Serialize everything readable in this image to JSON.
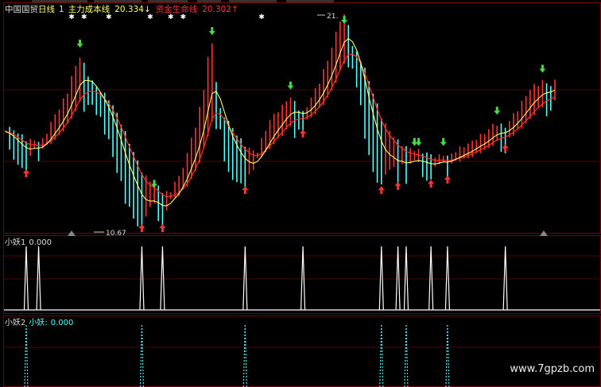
{
  "header": {
    "stock_name": "中国国贸",
    "period": "日线",
    "indicator_index": "1",
    "cost_line_label": "主力成本线",
    "cost_line_value": "20.334",
    "cost_line_arrow": "↓",
    "lifeline_label": "资金生命线",
    "lifeline_value": "20.302",
    "lifeline_arrow": "↑"
  },
  "main_panel": {
    "high_label": "21.",
    "low_label": "10.67"
  },
  "sub_panel_1": {
    "label": "小妖1",
    "value": "0.000"
  },
  "sub_panel_2": {
    "label": "小妖2",
    "legend": "小妖:",
    "value": "0.000"
  },
  "watermark": "www.7gpzb.com",
  "colors": {
    "up": "#ff3333",
    "down": "#54ffff",
    "cost_line": "#ffff66",
    "lifeline": "#ff2a2a",
    "panel_border": "#7a0000",
    "grid": "#5a0000",
    "buy_arrow": "#ff3333",
    "sell_arrow": "#44dd44",
    "spike_1": "#ffffff",
    "spike_2": "#54ffff"
  },
  "chart_data": {
    "type": "line",
    "price_range": [
      10.67,
      21.0
    ],
    "closes": [
      15.4,
      15.1,
      14.8,
      14.5,
      14.3,
      14.2,
      14.4,
      14.7,
      14.6,
      14.8,
      15.2,
      15.6,
      16.0,
      16.3,
      16.7,
      17.1,
      17.8,
      18.3,
      18.8,
      18.4,
      17.9,
      17.6,
      17.0,
      16.5,
      16.1,
      15.6,
      14.9,
      14.2,
      13.5,
      12.8,
      12.3,
      12.0,
      11.6,
      11.3,
      11.5,
      11.9,
      12.1,
      11.8,
      11.5,
      11.8,
      12.3,
      12.8,
      13.0,
      13.6,
      14.1,
      14.9,
      15.4,
      16.3,
      17.3,
      18.7,
      19.4,
      17.6,
      16.0,
      14.7,
      14.1,
      13.8,
      13.7,
      13.5,
      13.4,
      13.5,
      13.7,
      14.2,
      14.8,
      15.3,
      15.7,
      16.0,
      16.2,
      16.4,
      16.7,
      16.8,
      16.6,
      16.3,
      16.1,
      16.4,
      16.8,
      17.2,
      17.6,
      18.1,
      18.6,
      19.2,
      19.9,
      20.6,
      21.0,
      20.3,
      19.3,
      18.3,
      17.1,
      15.9,
      14.8,
      14.2,
      13.7,
      13.4,
      13.5,
      13.7,
      13.8,
      13.6,
      13.9,
      13.7,
      14.0,
      14.1,
      14.1,
      13.9,
      13.8,
      13.7,
      13.8,
      14.0,
      14.1,
      13.9,
      14.1,
      14.3,
      14.4,
      14.5,
      14.6,
      14.7,
      14.9,
      15.0,
      15.1,
      15.3,
      15.5,
      15.6,
      15.5,
      15.4,
      15.7,
      16.0,
      16.3,
      16.6,
      16.9,
      17.2,
      17.4,
      17.5,
      17.6,
      17.5,
      17.4,
      17.6
    ]
  }
}
